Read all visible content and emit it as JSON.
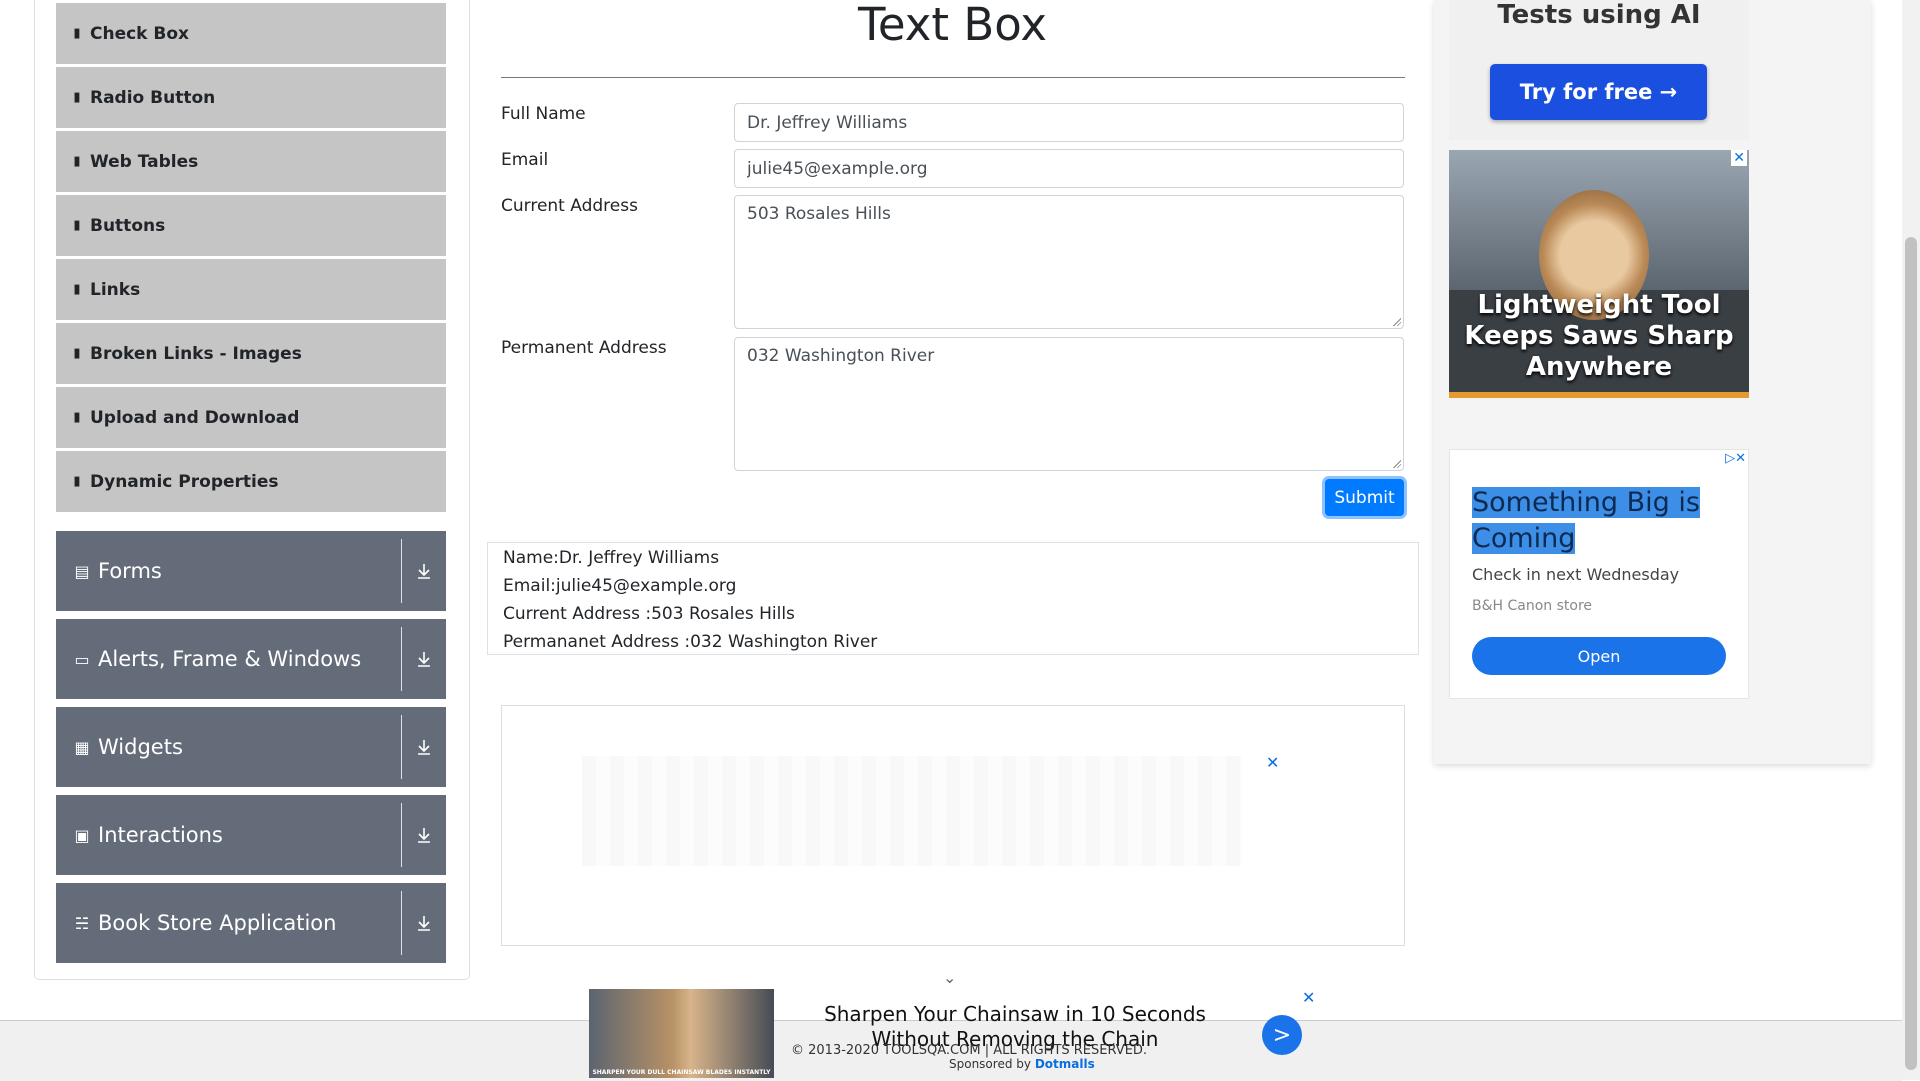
{
  "sidebar": {
    "sub_items": [
      {
        "label": "Check Box",
        "icon": "document-icon"
      },
      {
        "label": "Radio Button",
        "icon": "document-icon"
      },
      {
        "label": "Web Tables",
        "icon": "document-icon"
      },
      {
        "label": "Buttons",
        "icon": "document-icon"
      },
      {
        "label": "Links",
        "icon": "document-icon"
      },
      {
        "label": "Broken Links - Images",
        "icon": "document-icon"
      },
      {
        "label": "Upload and Download",
        "icon": "document-icon"
      },
      {
        "label": "Dynamic Properties",
        "icon": "document-icon"
      }
    ],
    "groups": [
      {
        "label": "Forms",
        "icon": "form-icon"
      },
      {
        "label": "Alerts, Frame & Windows",
        "icon": "window-icon"
      },
      {
        "label": "Widgets",
        "icon": "widgets-icon"
      },
      {
        "label": "Interactions",
        "icon": "interactions-icon"
      },
      {
        "label": "Book Store Application",
        "icon": "books-icon"
      }
    ]
  },
  "form": {
    "title": "Text Box",
    "full_name": {
      "label": "Full Name",
      "value": "Dr. Jeffrey Williams"
    },
    "email": {
      "label": "Email",
      "value": "julie45@example.org"
    },
    "current_address": {
      "label": "Current Address",
      "value": "503 Rosales Hills"
    },
    "permanent_address": {
      "label": "Permanent Address",
      "value": "032 Washington River"
    },
    "submit_label": "Submit"
  },
  "output": {
    "name": "Name:Dr. Jeffrey Williams",
    "email": "Email:julie45@example.org",
    "current_address": "Current Address :503 Rosales Hills",
    "permanent_address": "Permananet Address :032 Washington River"
  },
  "ads": {
    "ai_head": "Tests using AI",
    "ai_button": "Try for free →",
    "saw_caption": "Lightweight Tool Keeps Saws Sharp Anywhere",
    "canon_headline": "Something Big is Coming",
    "canon_sub": "Check in next Wednesday",
    "canon_store": "B&H Canon store",
    "canon_open": "Open",
    "sticky_text": "Sharpen Your Chainsaw in 10 Seconds Without Removing the Chain",
    "sticky_go": ">"
  },
  "footer": {
    "copyright": "© 2013-2020 TOOLSQA.COM | ALL RIGHTS RESERVED.",
    "sponsored_by": "Sponsored by",
    "sponsor": "Dotmalls"
  },
  "colors": {
    "sidebar_sub_bg": "#c5c5c5",
    "sidebar_group_bg": "#646c7a",
    "primary": "#007bff"
  }
}
